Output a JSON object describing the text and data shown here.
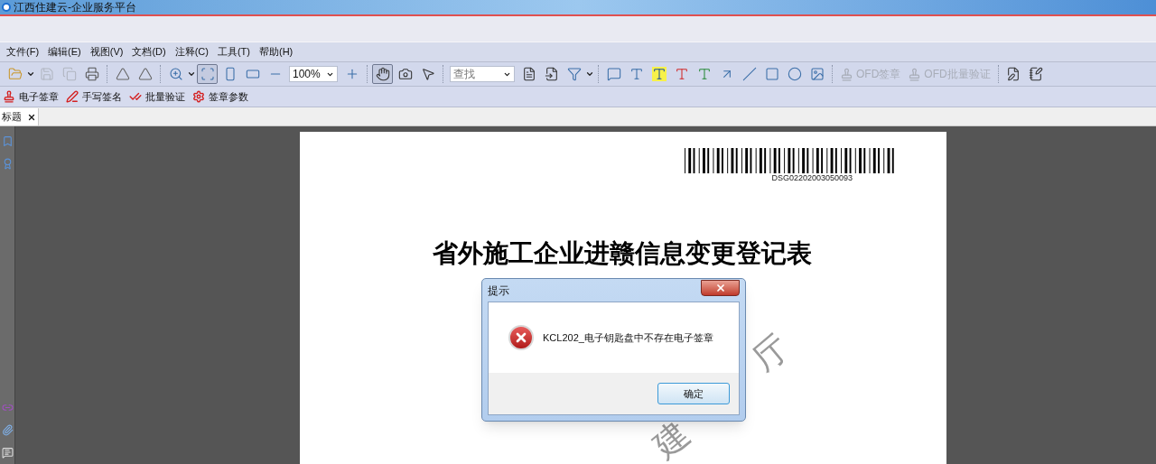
{
  "window": {
    "title": "江西住建云-企业服务平台"
  },
  "menu": [
    "文件(F)",
    "编辑(E)",
    "视图(V)",
    "文档(D)",
    "注释(C)",
    "工具(T)",
    "帮助(H)"
  ],
  "toolbar": [
    {
      "kind": "icon",
      "selected": false,
      "disabled": false
    },
    {
      "kind": "caret"
    },
    {
      "kind": "icon",
      "selected": false,
      "disabled": true
    },
    {
      "kind": "icon",
      "selected": false,
      "disabled": true
    },
    {
      "kind": "icon",
      "selected": false,
      "disabled": false
    },
    {
      "kind": "separator"
    },
    {
      "kind": "icon",
      "selected": false,
      "disabled": false
    },
    {
      "kind": "icon",
      "selected": false,
      "disabled": false
    },
    {
      "kind": "separator"
    },
    {
      "kind": "icon",
      "selected": false,
      "disabled": false
    },
    {
      "kind": "caret"
    },
    {
      "kind": "icon",
      "selected": true,
      "disabled": false
    },
    {
      "kind": "icon",
      "selected": false,
      "disabled": false
    },
    {
      "kind": "icon",
      "selected": false,
      "disabled": false
    },
    {
      "kind": "icon",
      "selected": false,
      "disabled": false
    },
    {
      "kind": "zoom_box",
      "value": "100%"
    },
    {
      "kind": "icon",
      "selected": false,
      "disabled": false
    },
    {
      "kind": "separator"
    },
    {
      "kind": "icon",
      "selected": true,
      "disabled": false
    },
    {
      "kind": "icon",
      "selected": false,
      "disabled": false
    },
    {
      "kind": "icon",
      "selected": false,
      "disabled": false
    },
    {
      "kind": "separator"
    },
    {
      "kind": "search_box",
      "value": "查找"
    },
    {
      "kind": "icon",
      "selected": false,
      "disabled": false
    },
    {
      "kind": "icon",
      "selected": false,
      "disabled": false
    },
    {
      "kind": "icon",
      "selected": false,
      "disabled": false
    },
    {
      "kind": "caret"
    },
    {
      "kind": "separator"
    },
    {
      "kind": "icon",
      "selected": false,
      "disabled": false
    },
    {
      "kind": "icon",
      "selected": false,
      "disabled": false
    },
    {
      "kind": "icon",
      "selected": false,
      "disabled": false
    },
    {
      "kind": "icon",
      "selected": false,
      "disabled": false
    },
    {
      "kind": "icon",
      "selected": false,
      "disabled": false
    },
    {
      "kind": "icon",
      "selected": false,
      "disabled": false
    },
    {
      "kind": "icon",
      "selected": false,
      "disabled": false
    },
    {
      "kind": "icon",
      "selected": false,
      "disabled": false
    },
    {
      "kind": "icon",
      "selected": false,
      "disabled": false
    },
    {
      "kind": "icon",
      "selected": false,
      "disabled": false
    },
    {
      "kind": "separator"
    },
    {
      "kind": "text",
      "label": "OFD签章",
      "disabled": true
    },
    {
      "kind": "text",
      "label": "OFD批量验证",
      "disabled": true
    },
    {
      "kind": "separator"
    },
    {
      "kind": "icon",
      "selected": false,
      "disabled": false
    },
    {
      "kind": "icon",
      "selected": false,
      "disabled": false
    }
  ],
  "sign_toolbar": [
    "电子签章",
    "手写签名",
    "批量验证",
    "签章参数"
  ],
  "tabs": [
    {
      "label": "标题",
      "selected": true
    }
  ],
  "document": {
    "barcode": "DSG02202003050093",
    "title": "省外施工企业进赣信息变更登记表",
    "stamp_text": [
      "厅",
      "建"
    ]
  },
  "dialog": {
    "title": "提示",
    "message": "KCL202_电子钥匙盘中不存在电子签章",
    "button": "确定"
  }
}
